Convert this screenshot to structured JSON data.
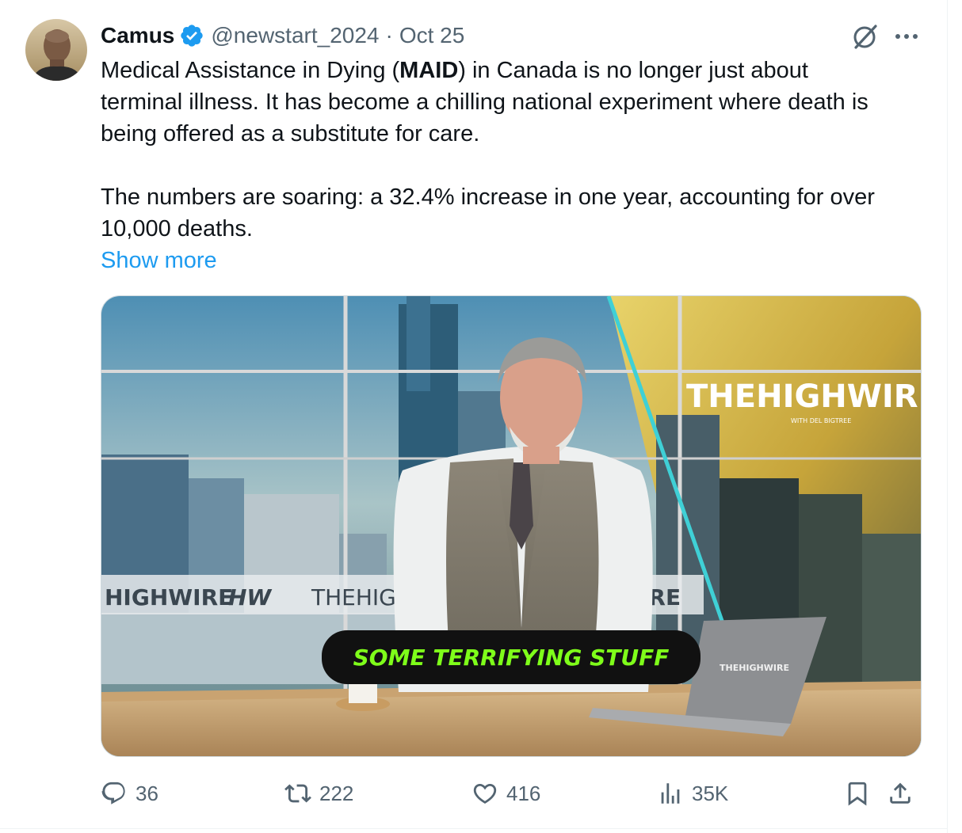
{
  "tweet": {
    "author_name": "Camus",
    "handle": "@newstart_2024",
    "separator": "·",
    "date": "Oct 25",
    "text_line1_a": "Medical Assistance in Dying (",
    "text_line1_bold": "MAID",
    "text_line1_b": ") in Canada is no longer just about",
    "text_line2": "terminal illness. It has become a chilling national experiment where death is",
    "text_line3": "being offered as a substitute for care.",
    "text_line4": "The numbers are soaring: a 32.4% increase in one year, accounting for over",
    "text_line5": "10,000 deaths.",
    "show_more": "Show more"
  },
  "media": {
    "brand_main": "THEHIGHWIRE",
    "brand_sub": "WITH DEL BIGTREE",
    "banner_text_1": "HIGHWIRE",
    "banner_text_2": "HW",
    "banner_text_3": "THEHIGH",
    "banner_text_4": "IRE",
    "caption": "SOME TERRIFYING STUFF",
    "laptop_logo": "THEHIGHWIRE"
  },
  "actions": {
    "replies": "36",
    "reposts": "222",
    "likes": "416",
    "views": "35K"
  },
  "colors": {
    "link": "#1d9bf0",
    "verified": "#1d9bf0",
    "muted": "#536471",
    "caption_green": "#7fff1a"
  },
  "icons": {
    "verified": "verified-badge-icon",
    "grok": "grok-icon",
    "more": "more-icon",
    "reply": "reply-icon",
    "repost": "repost-icon",
    "like": "like-icon",
    "views": "views-icon",
    "bookmark": "bookmark-icon",
    "share": "share-icon"
  }
}
